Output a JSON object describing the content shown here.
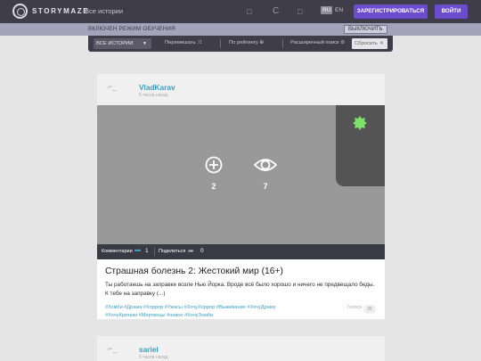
{
  "header": {
    "logo_text": "STORYMAZE",
    "nav_all_stories": "Все истории",
    "lang_ru": "RU",
    "lang_en": "EN",
    "register_label": "ЗАРЕГИСТРИРОВАТЬСЯ",
    "login_label": "ВОЙТИ"
  },
  "training": {
    "text": "ВКЛЮЧЕН РЕЖИМ ОБУЧЕНИЯ",
    "disable_label": "ВЫКЛЮЧИТЬ"
  },
  "filters": {
    "select_value": "ВСЕ ИСТОРИИ",
    "shuffle_label": "Перемешать",
    "rating_label": "По рейтингу",
    "advanced_search_label": "Расширенный поиск",
    "reset_label": "Сбросить"
  },
  "stories": [
    {
      "author": "VladKarav",
      "ago": "5 часов назад",
      "add_count": "2",
      "view_count": "7",
      "comments_label": "Комментарии",
      "comments_count": "1",
      "share_label": "Поделиться",
      "share_count": "0",
      "title": "Страшная болезнь 2: Жестокий мир (16+)",
      "text": "Ты работаешь на заправке возле Нью Йорка. Вроде всё было хорошо и ничего не предвещало беды. К тебе на заправку (...)",
      "tags_line1": "#Зомби #Драма #Хоррор #Ужасы #ХочуХоррор #Выживание #ХочуДраму",
      "tags_line2": "#ХочуКритики #Мертвецы #новое #ХочуЗомби",
      "views_label": "Голоса",
      "views_count": "35"
    },
    {
      "author": "sariel",
      "ago": "5 часов назад"
    }
  ]
}
